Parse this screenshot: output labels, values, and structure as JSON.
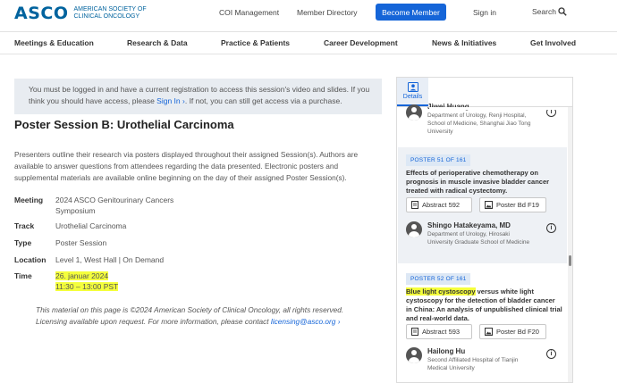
{
  "header": {
    "logo_word": "ASCO",
    "logo_line1": "AMERICAN SOCIETY OF",
    "logo_line2": "CLINICAL ONCOLOGY",
    "links": [
      "COI Management",
      "Member Directory"
    ],
    "become_member": "Become Member",
    "sign_in": "Sign in",
    "search": "Search"
  },
  "nav": [
    "Meetings & Education",
    "Research & Data",
    "Practice & Patients",
    "Career Development",
    "News & Initiatives",
    "Get Involved"
  ],
  "notice": {
    "part1": "You must be logged in and have a current registration to access this session's video and slides. If you think you should have access, please ",
    "link": "Sign In",
    "link_suffix": " ›",
    "part2": ". If not, you can still get access via a purchase."
  },
  "session": {
    "title": "Poster Session B: Urothelial Carcinoma",
    "description": "Presenters outline their research via posters displayed throughout their assigned Session(s). Authors are available to answer questions from attendees regarding the data presented. Electronic posters and supplemental materials are available online beginning on the day of their assigned Poster Session(s).",
    "meeting_label": "Meeting",
    "meeting": "2024 ASCO Genitourinary Cancers Symposium",
    "track_label": "Track",
    "track": "Urothelial Carcinoma",
    "type_label": "Type",
    "type": "Poster Session",
    "location_label": "Location",
    "location": "Level 1, West Hall | On Demand",
    "time_label": "Time",
    "date": "26. januar 2024",
    "time": "11:30 – 13:00 PST"
  },
  "footer": {
    "text": "This material on this page is ©2024 American Society of Clinical Oncology, all rights reserved. Licensing available upon request. For more information, please contact ",
    "email": "licensing@asco.org",
    "suffix": " ›"
  },
  "panel": {
    "tab_label": "Details",
    "prev_author": {
      "name": "Jiwei Huang",
      "affiliation": "Department of Urology, Renji Hospital, School of Medicine, Shanghai Jiao Tong University"
    },
    "posters": [
      {
        "badge": "POSTER 51 OF 161",
        "title": "Effects of perioperative chemotherapy on prognosis in muscle invasive bladder cancer treated with radical cystectomy.",
        "title_highlight": "",
        "abstract": "Abstract 592",
        "board": "Poster Bd F19",
        "author": "Shingo Hatakeyama, MD",
        "affiliation": "Department of Urology, Hirosaki University Graduate School of Medicine"
      },
      {
        "badge": "POSTER 52 OF 161",
        "title_highlight": "Blue light cystoscopy",
        "title": " versus white light cystoscopy for the detection of bladder cancer in China: An analysis of unpublished clinical trial and real-world data.",
        "abstract": "Abstract 593",
        "board": "Poster Bd F20",
        "author": "Hailong Hu",
        "affiliation": "Second Affiliated Hospital of Tianjin Medical University"
      }
    ]
  },
  "colors": {
    "brand": "#00639e",
    "accent": "#1565d8",
    "highlight": "#f4ff3c"
  }
}
